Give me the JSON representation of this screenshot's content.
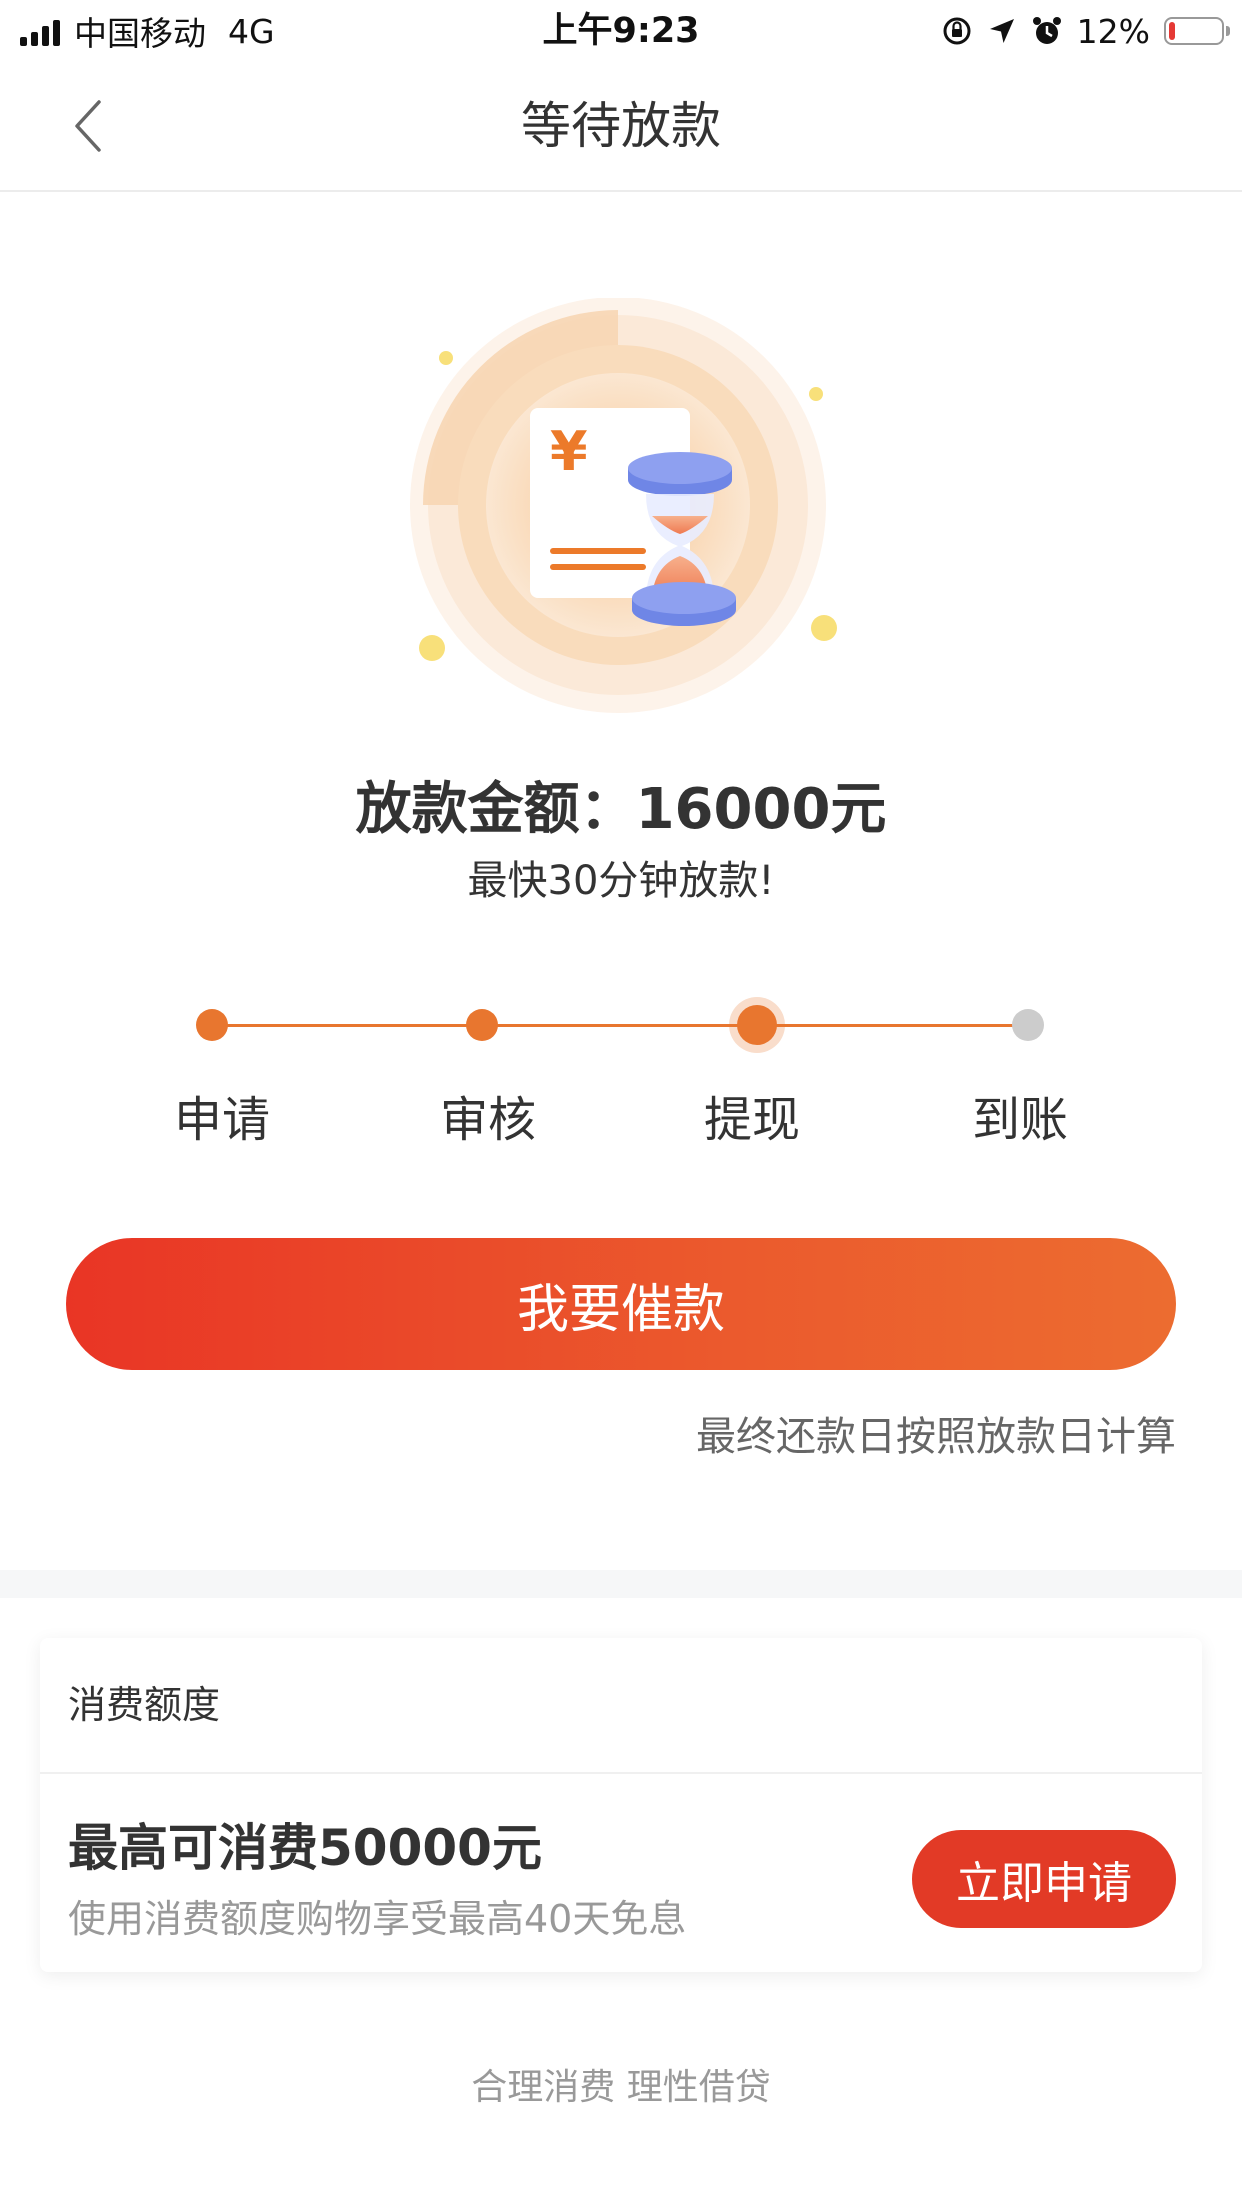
{
  "status_bar": {
    "carrier": "中国移动",
    "network": "4G",
    "time": "上午9:23",
    "battery": "12%",
    "battery_level": 0.12,
    "icons": [
      "signal-icon",
      "orientation-lock-icon",
      "location-icon",
      "alarm-icon",
      "battery-icon"
    ]
  },
  "nav": {
    "title": "等待放款",
    "back_icon": "back-chevron-icon"
  },
  "illustration": {
    "icon": "hourglass-document-icon",
    "currency_symbol": "¥",
    "colors": {
      "accent": "#ec7a2a",
      "hourglass": "#6f86e6",
      "sand": "#f08a5b"
    }
  },
  "main": {
    "amount_text": "放款金额：16000元",
    "subtitle": "最快30分钟放款!"
  },
  "progress": {
    "steps": [
      {
        "label": "申请",
        "status": "done"
      },
      {
        "label": "审核",
        "status": "done"
      },
      {
        "label": "提现",
        "status": "current"
      },
      {
        "label": "到账",
        "status": "pending"
      }
    ],
    "colors": {
      "active": "#e8762f",
      "inactive": "#cccccc"
    }
  },
  "actions": {
    "urge_button": "我要催款",
    "note": "最终还款日按照放款日计算"
  },
  "card": {
    "header": "消费额度",
    "big_text": "最高可消费50000元",
    "small_text": "使用消费额度购物享受最高40天免息",
    "apply_button": "立即申请"
  },
  "footer": {
    "text": "合理消费 理性借贷"
  }
}
